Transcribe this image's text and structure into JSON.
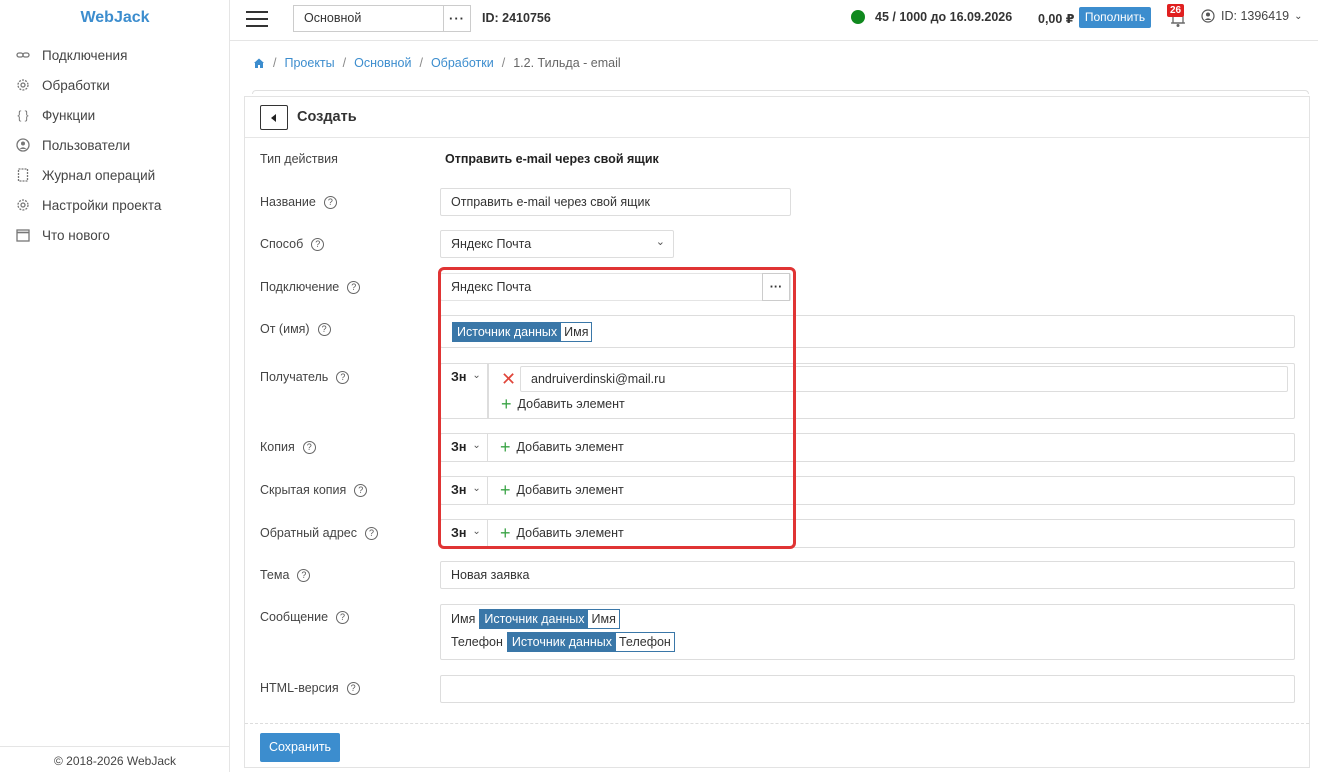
{
  "sidebar": {
    "brand": "WebJack",
    "items": [
      {
        "label": "Подключения",
        "icon": "link-icon"
      },
      {
        "label": "Обработки",
        "icon": "gear-icon"
      },
      {
        "label": "Функции",
        "icon": "braces-icon"
      },
      {
        "label": "Пользователи",
        "icon": "user-icon"
      },
      {
        "label": "Журнал операций",
        "icon": "log-icon"
      },
      {
        "label": "Настройки проекта",
        "icon": "settings-icon"
      },
      {
        "label": "Что нового",
        "icon": "calendar-icon"
      }
    ],
    "footer": "© 2018-2026 WebJack"
  },
  "topbar": {
    "project_select": "Основной",
    "project_id": "ID: 2410756",
    "quota": "45 / 1000 до 16.09.2026",
    "balance": "0,00 ₽",
    "topup_label": "Пополнить",
    "notifications": "26",
    "user_id": "ID: 1396419"
  },
  "breadcrumb": {
    "items": [
      "Проекты",
      "Основной",
      "Обработки"
    ],
    "current": "1.2. Тильда - email"
  },
  "form": {
    "title": "Создать",
    "action_type_label": "Тип действия",
    "action_type_value": "Отправить e-mail через свой ящик",
    "name_label": "Название",
    "name_value": "Отправить e-mail через свой ящик",
    "method_label": "Способ",
    "method_value": "Яндекс Почта",
    "connection_label": "Подключение",
    "connection_value": "Яндекс Почта",
    "from_label": "От (имя)",
    "from_chip": {
      "source": "Источник данных",
      "field": "Имя"
    },
    "to_label": "Получатель",
    "to_value": "andruiverdinski@mail.ru",
    "cc_label": "Копия",
    "bcc_label": "Скрытая копия",
    "reply_label": "Обратный адрес",
    "zn": "Зн",
    "add_element": "Добавить элемент",
    "subject_label": "Тема",
    "subject_value": "Новая заявка",
    "message_label": "Сообщение",
    "message_line1_prefix": "Имя",
    "message_line1_chip": {
      "source": "Источник данных",
      "field": "Имя"
    },
    "message_line2_prefix": "Телефон",
    "message_line2_chip": {
      "source": "Источник данных",
      "field": "Телефон"
    },
    "html_label": "HTML-версия",
    "html_value": "",
    "help_glyph": "?",
    "save_label": "Сохранить"
  },
  "colors": {
    "accent": "#3c8dce",
    "chip": "#3a77a8",
    "status_green": "#10891e",
    "highlight": "#e03434",
    "add_green": "#3aa346"
  }
}
